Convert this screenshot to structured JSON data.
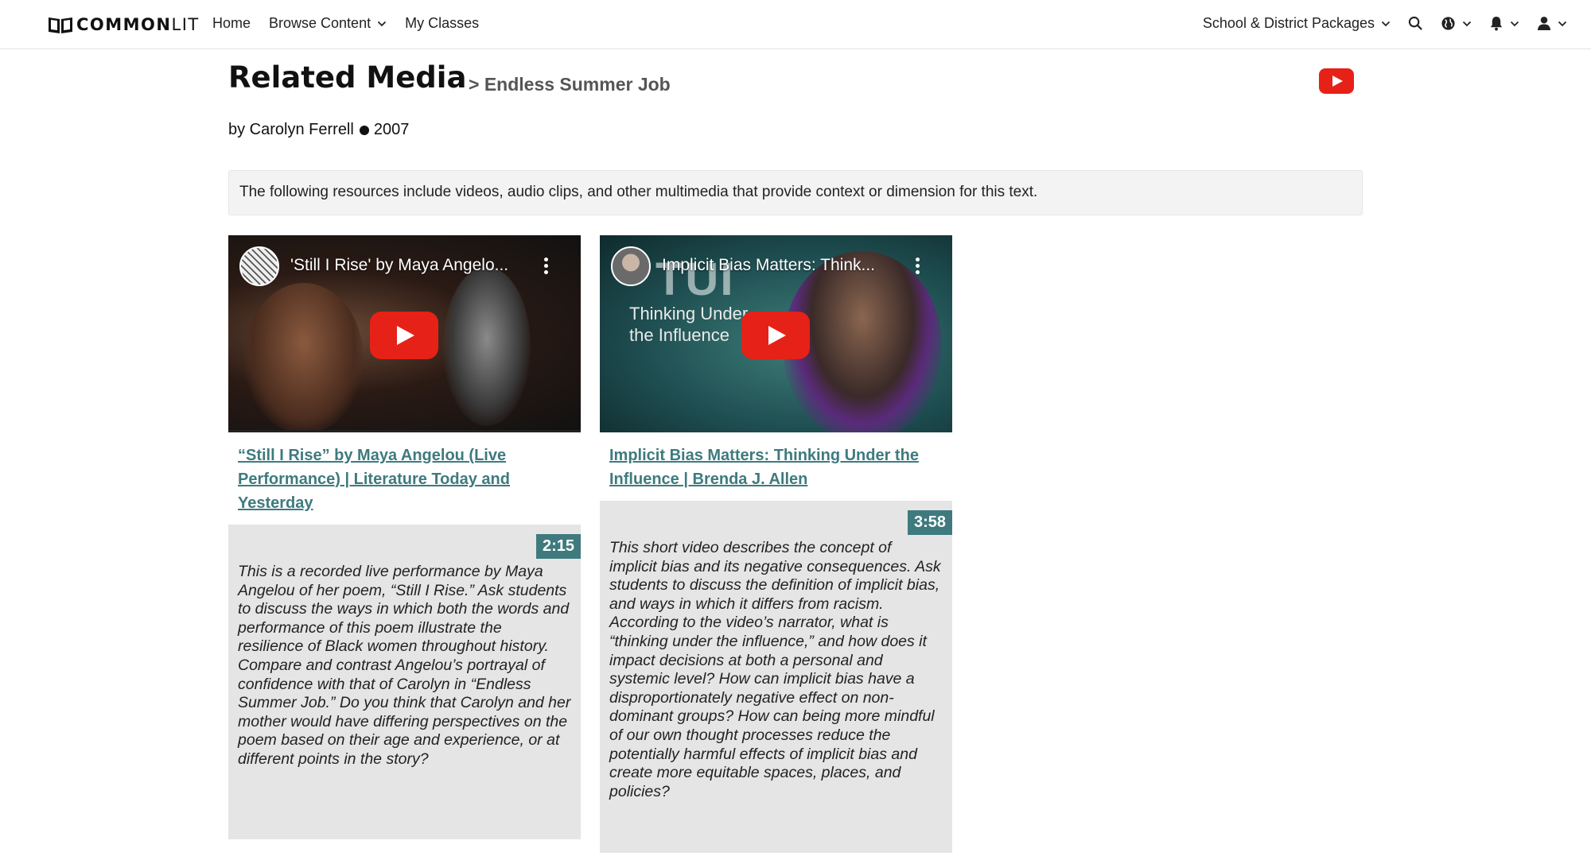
{
  "nav": {
    "logo_bold": "COMMON",
    "logo_light": "LIT",
    "home": "Home",
    "browse": "Browse Content",
    "classes": "My Classes",
    "packages": "School & District Packages"
  },
  "header": {
    "title": "Related Media",
    "breadcrumb": "> Endless Summer Job",
    "author": "by Carolyn Ferrell",
    "year": "2007"
  },
  "intro": "The following resources include videos, audio clips, and other multimedia that provide context or dimension for this text.",
  "videos": [
    {
      "thumb_title": "'Still I Rise' by Maya Angelo...",
      "link": "“Still I Rise” by Maya Angelou (Live Performance) | Literature Today and Yesterday",
      "duration": "2:15",
      "description": "This is a recorded live performance by Maya Angelou of her poem, “Still I Rise.” Ask students to discuss the ways in which both the words and performance of this poem illustrate the resilience of Black women throughout history. Compare and contrast Angelou’s portrayal of confidence with that of Carolyn in “Endless Summer Job.” Do you think that Carolyn and her mother would have differing perspectives on the poem based on their age and experience, or at different points in the story?"
    },
    {
      "thumb_title": "Implicit Bias Matters: Think...",
      "thumb_overlay": "Thinking Under the Influence",
      "thumb_overlay_big": "TUI",
      "link": "Implicit Bias Matters: Thinking Under the Influence | Brenda J. Allen",
      "duration": "3:58",
      "description": "This short video describes the concept of implicit bias and its negative consequences. Ask students to discuss the definition of implicit bias, and ways in which it differs from racism. According to the video’s narrator, what is “thinking under the influence,” and how does it impact decisions at both a personal and systemic level? How can implicit bias have a disproportionately negative effect on non-dominant groups? How can being more mindful of our own thought processes reduce the potentially harmful effects of implicit bias and create more equitable spaces, places, and policies?"
    }
  ],
  "colors": {
    "accent": "#3e7a7e",
    "youtube_red": "#e62117"
  }
}
